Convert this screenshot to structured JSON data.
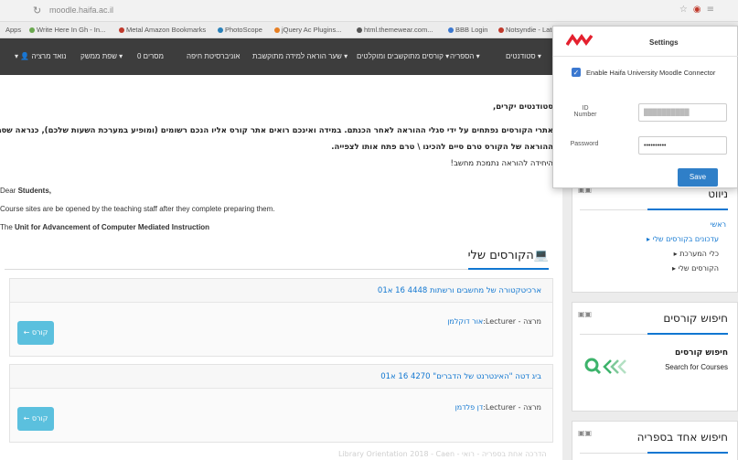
{
  "browser": {
    "url": "moodle.haifa.ac.il",
    "bookmarks": [
      "Apps",
      "Write Here In Gh - In...",
      "Metal Amazon Bookmarks",
      "PhotoScope",
      "jQuery Ac Plugins...",
      "html.themewear.com...",
      "BBB Login",
      "Notsyndie - Latest...",
      "We"
    ]
  },
  "navbar": {
    "items": [
      "סטודנטים",
      "הספריה",
      "קורסים מתוקשבים ומוקלטים",
      "שער הוראה למידה מתוקשבת",
      "אוניברסיטת חיפה",
      "0 מסרים",
      "שפת ממשק",
      "נואד מרציה"
    ]
  },
  "notice": {
    "greeting_he": "סטודנטים יקרים,",
    "line1_he": "אתרי הקורסים נפתחים על ידי סגלי ההוראה לאחר הכנתם. במידה ואינכם רואים אתר קורס אליו הנכם רשומים (ומופיע במערכת השעות שלכם), כנראה שסגל",
    "line2_he": "ההוראה של הקורס טרם סיים להכינו \\ טרם פתח אותו לצפייה.",
    "sign_he": "היחידה להוראה נתמכת מחשב!",
    "greeting_en_prefix": "Dear ",
    "greeting_en_bold": "Students,",
    "line_en": "Course sites are be opened by the teaching staff after they complete preparing them.",
    "sign_en_prefix": "The ",
    "sign_en_bold": "Unit for Advancement of Computer Mediated Instruction"
  },
  "my_courses": {
    "title": "הקורסים שלי",
    "courses": [
      {
        "name": "ארכיטקטורה של מחשבים ורשתות 4448 16 א01",
        "teacher_label": "מרצה - Lecturer:",
        "teacher": "אור דוקלמן",
        "enter": "קורס"
      },
      {
        "name": "ביג דטה \"האינטרנט של הדברים\" 4270 16 א01",
        "teacher_label": "מרצה - Lecturer:",
        "teacher": "דן פלדמן",
        "enter": "קורס"
      }
    ],
    "faded": "Library Orientation 2018 - Caen - הדרכה אחת בספריה - רואי"
  },
  "sidebar": {
    "nav": {
      "title": "ניווט",
      "items": [
        {
          "label": "ראשי",
          "link": true
        },
        {
          "label": "עדכונים בקורסים שלי",
          "link": true
        },
        {
          "label": "כלי המערכת",
          "link": false
        },
        {
          "label": "הקורסים שלי",
          "link": false
        }
      ]
    },
    "course_search": {
      "title": "חיפוש קורסים",
      "inner_title": "חיפוש קורסים",
      "inner_sub": "Search for Courses"
    },
    "library_search": {
      "title": "חיפוש אחד בספריה"
    }
  },
  "popup": {
    "title": "Settings",
    "enable_label": "Enable Haifa University Moodle Connector",
    "id_label": "ID Number",
    "password_label": "Password",
    "password_value": "••••••••••",
    "save": "Save"
  },
  "colors": {
    "accent": "#1177d1",
    "navbar": "#3d3d3d",
    "save": "#2f7fc8",
    "logo": "#e4202e",
    "enter": "#5bc0de"
  }
}
